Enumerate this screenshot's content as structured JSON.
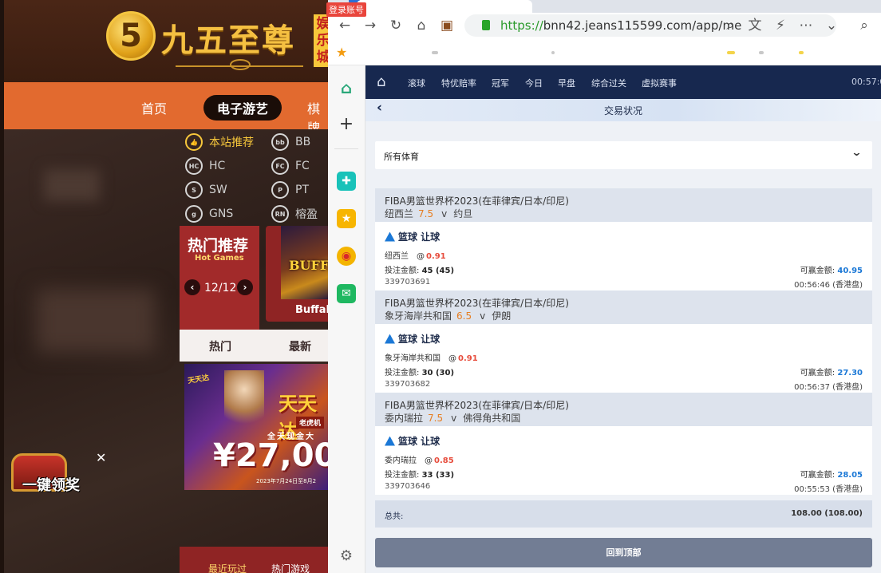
{
  "site": {
    "logo_text": "九五至尊",
    "logo_tag": "娱乐城",
    "nav": {
      "home": "首页",
      "games": "电子游艺",
      "chess": "棋牌"
    },
    "providers": [
      {
        "label": "本站推荐",
        "icon": "thumbs-up-icon"
      },
      {
        "label": "BB",
        "icon": "bb-icon"
      },
      {
        "label": "HC",
        "icon": "hc-icon"
      },
      {
        "label": "FC",
        "icon": "fc-icon"
      },
      {
        "label": "SW",
        "icon": "sw-icon"
      },
      {
        "label": "PT",
        "icon": "pt-icon"
      },
      {
        "label": "GNS",
        "icon": "gns-icon"
      },
      {
        "label": "榕盈",
        "icon": "rongying-icon"
      }
    ],
    "hot": {
      "title": "热门推荐",
      "subtitle": "Hot Games",
      "page": "12/12"
    },
    "game_card": {
      "name": "Buffalo",
      "art": "BUFFALO"
    },
    "tabs": {
      "hot": "热门",
      "new": "最新"
    },
    "banner": {
      "brand": "天天达",
      "title": "天天达",
      "sub": "老虎机",
      "line": "全天现金大",
      "amount": "¥27,000",
      "date": "2023年7月24日至8月2"
    },
    "chest_label": "一键领奖",
    "bottom": {
      "recent": "最近玩过",
      "hot_games": "热门游戏"
    },
    "login_badge": "登录账号"
  },
  "browser": {
    "url_proto": "https://",
    "url_rest": "bnn42.jeans115599.com/app/me"
  },
  "app": {
    "nav": [
      "滚球",
      "特优赔率",
      "冠军",
      "今日",
      "早盘",
      "综合过关",
      "虚拟赛事"
    ],
    "time": "00:57:0",
    "page_title": "交易状况",
    "sport_select": "所有体育",
    "bets": [
      {
        "league": "FIBA男篮世界杯2023(在菲律宾/日本/印尼)",
        "home": "纽西兰",
        "line": "7.5",
        "vs": "v",
        "away": "约旦",
        "type": "篮球 让球",
        "pick": "纽西兰",
        "at": "@",
        "odds": "0.91",
        "stake_label": "投注金额: ",
        "stake": "45 (45)",
        "win_label": "可赢金额: ",
        "win": "40.95",
        "id": "339703691",
        "time": "00:56:46 (香港盘)"
      },
      {
        "league": "FIBA男篮世界杯2023(在菲律宾/日本/印尼)",
        "home": "象牙海岸共和国",
        "line": "6.5",
        "vs": "v",
        "away": "伊朗",
        "type": "篮球 让球",
        "pick": "象牙海岸共和国",
        "at": "@",
        "odds": "0.91",
        "stake_label": "投注金额: ",
        "stake": "30 (30)",
        "win_label": "可赢金额: ",
        "win": "27.30",
        "id": "339703682",
        "time": "00:56:37 (香港盘)"
      },
      {
        "league": "FIBA男篮世界杯2023(在菲律宾/日本/印尼)",
        "home": "委内瑞拉",
        "line": "7.5",
        "vs": "v",
        "away": "佛得角共和国",
        "type": "篮球 让球",
        "pick": "委内瑞拉",
        "at": "@",
        "odds": "0.85",
        "stake_label": "投注金额: ",
        "stake": "33 (33)",
        "win_label": "可赢金额: ",
        "win": "28.05",
        "id": "339703646",
        "time": "00:55:53 (香港盘)"
      }
    ],
    "total_label": "总共:",
    "total_value": "108.00 (108.00)",
    "top_button": "回到顶部"
  }
}
